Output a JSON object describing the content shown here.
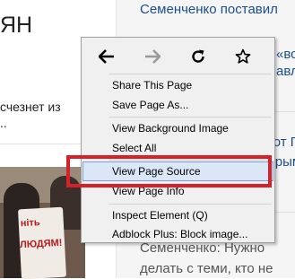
{
  "background_page": {
    "left_headline": "ЯН",
    "left_line1": "счезнет из",
    "left_line2": "..",
    "sign_line1": "ніть",
    "sign_line2": "ЛЮДЯМ!",
    "right_line1": "Семенченко поставил",
    "right_line2": "«вс",
    "right_line3": "авля",
    "right_line4": "зот П",
    "right_line5": "Крым»",
    "right_line6": "Семенченко: Нужно",
    "right_line7": "делать с теми, кто не"
  },
  "context_menu": {
    "nav": {
      "back_icon": "arrow-left-icon",
      "forward_icon": "arrow-right-icon",
      "reload_icon": "reload-icon",
      "bookmark_icon": "star-icon"
    },
    "items": [
      {
        "label": "Share This Page"
      },
      {
        "label": "Save Page As..."
      },
      {
        "label": "View Background Image"
      },
      {
        "label": "Select All"
      },
      {
        "label": "View Page Source"
      },
      {
        "label": "View Page Info"
      },
      {
        "label": "Inspect Element (Q)"
      },
      {
        "label": "Adblock Plus: Block image..."
      }
    ],
    "selected_item": "View Page Source"
  },
  "colors": {
    "highlight_border": "#d8202a",
    "menu_background": "#f0f0f0",
    "selected_item_background": "#dbe7f6"
  }
}
